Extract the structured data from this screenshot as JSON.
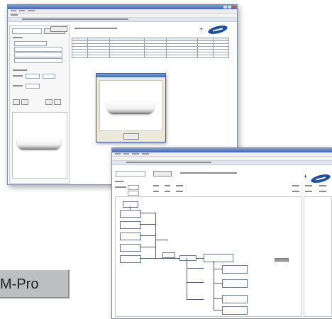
{
  "product_label": "M-Pro",
  "colors": {
    "title_bar": "#3c65b8",
    "selection": "#3f63c6",
    "brand_logo": "#1d4fa0",
    "label_box": "#bcbec0"
  },
  "windows": [
    {
      "id": "top-window",
      "icons": [
        "samsung-logo-icon",
        "plus-icon",
        "outdoor-unit-image"
      ],
      "has_dialog": true
    },
    {
      "id": "bottom-window",
      "icons": [
        "samsung-logo-icon",
        "plus-icon",
        "tree-diagram"
      ],
      "has_dialog": false
    }
  ],
  "plus_glyph": "+"
}
